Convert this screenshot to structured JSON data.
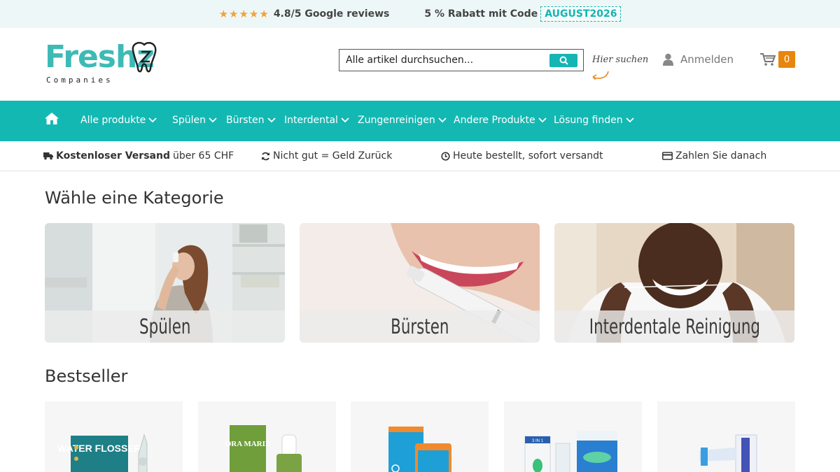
{
  "topbar": {
    "stars": "★★★★★",
    "reviews_text": "4.8/5 Google reviews",
    "discount_text": "5 % Rabatt mit Code",
    "discount_code": "AUGUST2026",
    "star_color": "#f3a233"
  },
  "header": {
    "logo_word": "Freshz",
    "logo_sub": "Companies",
    "search_placeholder": "Alle artikel durchsuchen...",
    "search_hint": "Hier suchen",
    "login_label": "Anmelden",
    "cart_count": "0",
    "accent_color": "#14b8b3",
    "cart_badge_color": "#e8850c"
  },
  "nav": {
    "home_icon": "home-icon",
    "items": [
      {
        "label": "Alle produkte"
      },
      {
        "label": "Spülen"
      },
      {
        "label": "Bürsten"
      },
      {
        "label": "Interdental"
      },
      {
        "label": "Zungenreinigen"
      },
      {
        "label": "Andere Produkte"
      },
      {
        "label": "Lösung finden"
      }
    ]
  },
  "usp": {
    "shipping_bold": "Kostenloser Versand",
    "shipping_rest": "über 65 CHF",
    "refund": "Nicht gut = Geld Zurück",
    "ship_fast": "Heute bestellt, sofort versandt",
    "pay_later": "Zahlen Sie danach"
  },
  "categories": {
    "heading": "Wähle eine Kategorie",
    "items": [
      {
        "label": "Spülen"
      },
      {
        "label": "Bürsten"
      },
      {
        "label": "Interdentale Reinigung"
      }
    ]
  },
  "bestseller": {
    "heading": "Bestseller",
    "products": [
      {
        "pack_text": "WATER FLOSSER"
      },
      {
        "pack_text": "ORA MARIE"
      },
      {
        "pack_text": ""
      },
      {
        "pack_text": "3 IN 1"
      },
      {
        "pack_text": ""
      }
    ]
  }
}
